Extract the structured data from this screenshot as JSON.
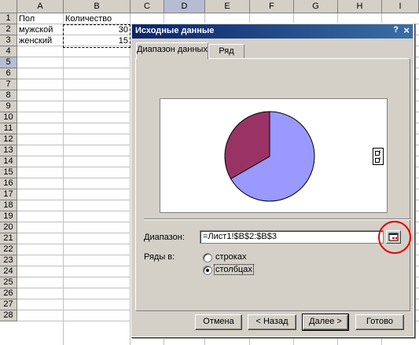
{
  "sheet": {
    "columns": [
      "A",
      "B",
      "C",
      "D",
      "E",
      "F",
      "G",
      "H",
      "I"
    ],
    "rows": [
      "1",
      "2",
      "3",
      "4",
      "5",
      "6",
      "7",
      "8",
      "9",
      "10",
      "11",
      "12",
      "13",
      "14",
      "15",
      "16",
      "17",
      "18",
      "19",
      "20",
      "21",
      "22",
      "23",
      "24",
      "25",
      "26",
      "27",
      "28"
    ],
    "cells": {
      "a1": "Пол",
      "b1": "Количество",
      "a2": "мужской",
      "b2": "30",
      "a3": "женский",
      "b3": "15"
    },
    "selected_column": "D",
    "selected_row": "5"
  },
  "dialog": {
    "title": "Исходные данные",
    "help_label": "?",
    "close_label": "×",
    "tabs": [
      {
        "label": "Диапазон данных",
        "active": true
      },
      {
        "label": "Ряд",
        "active": false
      }
    ],
    "pie": {
      "values": [
        30,
        15
      ],
      "colors": [
        "#9999ff",
        "#993366"
      ]
    },
    "legend": [
      "1",
      "2"
    ],
    "range_label": "Диапазон:",
    "range_value": "=Лист1!$B$2:$B$3",
    "series_in_label": "Ряды в:",
    "options": [
      {
        "label": "строках",
        "checked": false
      },
      {
        "label": "столбцах",
        "checked": true
      }
    ],
    "buttons": {
      "cancel": "Отмена",
      "back": "< Назад",
      "next": "Далее >",
      "finish": "Готово"
    },
    "highlight_color": "#e00000"
  }
}
